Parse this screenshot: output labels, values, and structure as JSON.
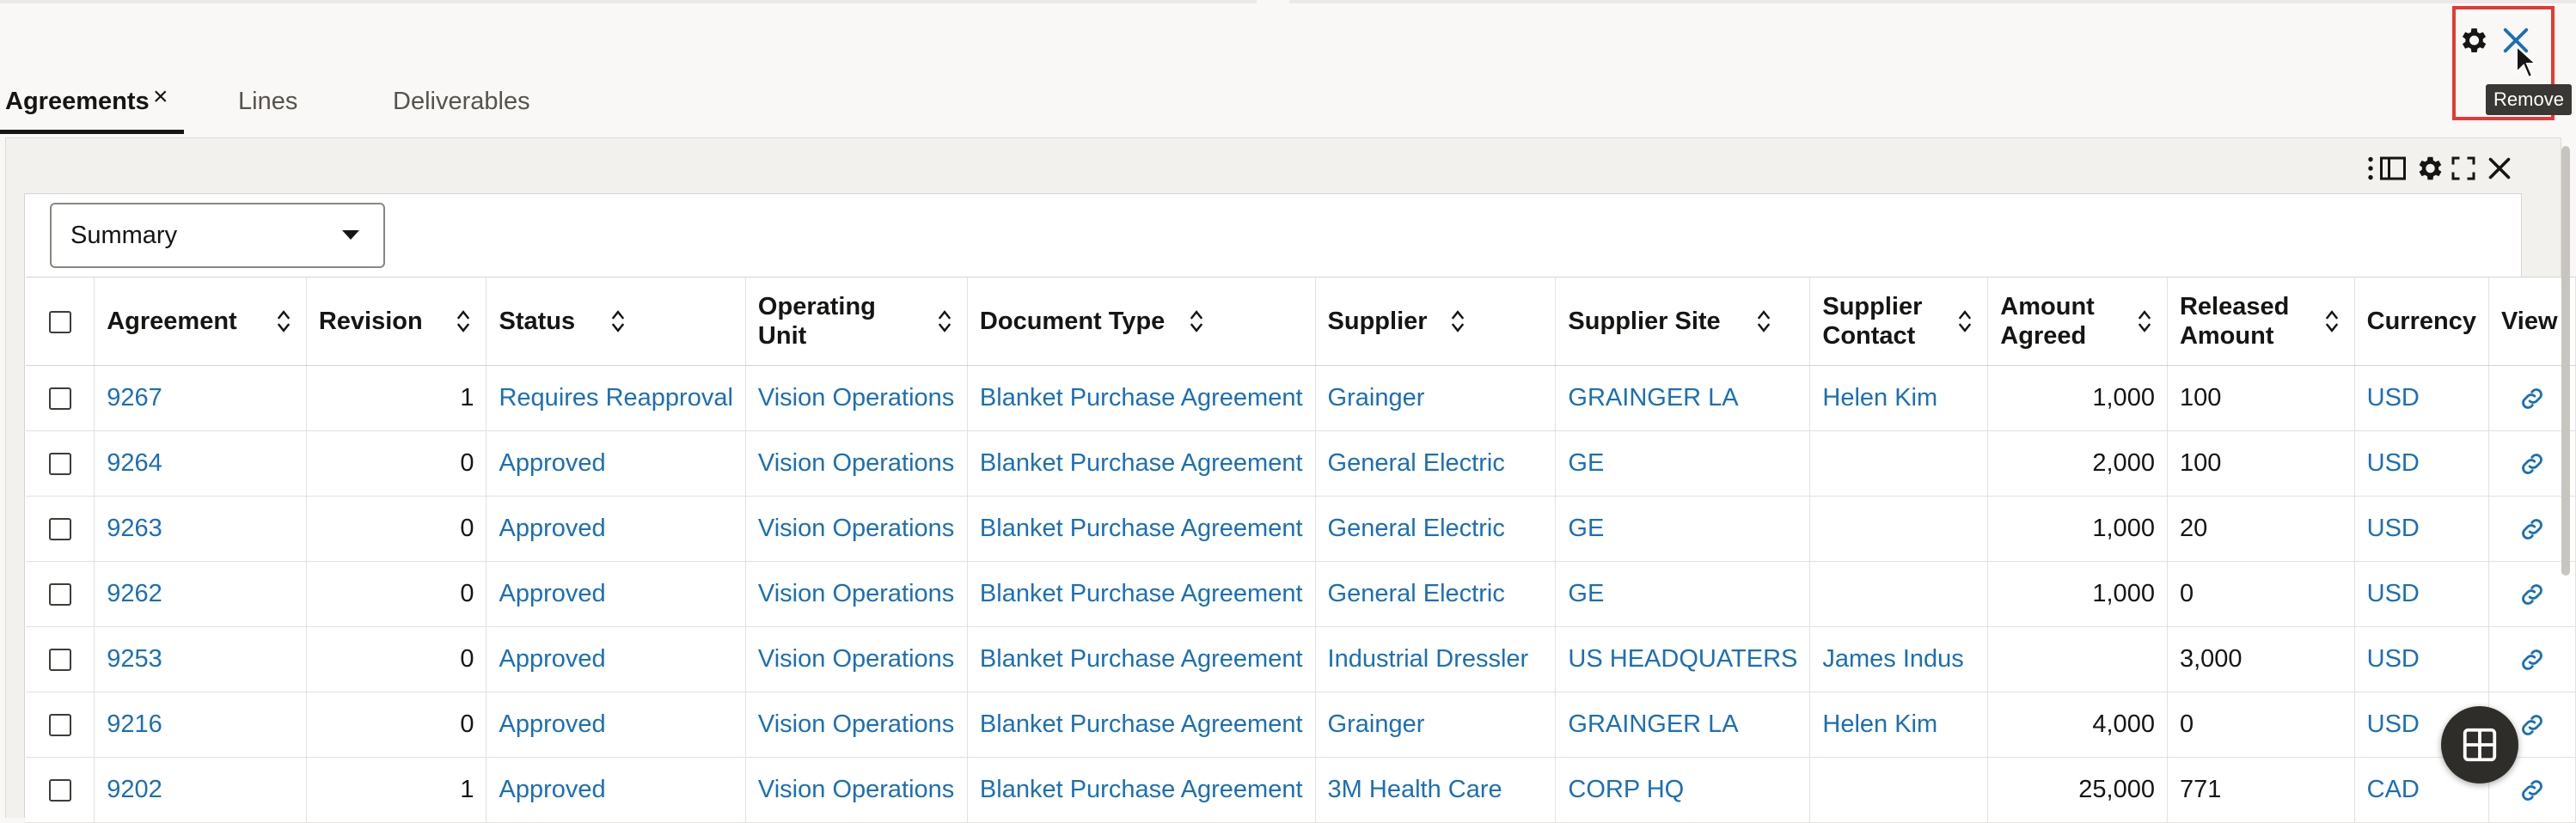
{
  "header": {
    "remove_tooltip": "Remove",
    "settings_icon": "gear-icon",
    "close_icon": "close-icon"
  },
  "tabs": [
    {
      "label": "Agreements",
      "active": true
    },
    {
      "label": "Lines",
      "active": false
    },
    {
      "label": "Deliverables",
      "active": false
    }
  ],
  "panel": {
    "tools": [
      "more-vertical-icon",
      "panel-toggle-icon",
      "gear-icon",
      "expand-icon",
      "close-icon"
    ]
  },
  "view_select": {
    "value": "Summary"
  },
  "table": {
    "columns": [
      {
        "label": "Agreement",
        "sortable": true
      },
      {
        "label": "Revision",
        "sortable": true
      },
      {
        "label": "Status",
        "sortable": true
      },
      {
        "label": "Operating Unit",
        "sortable": true
      },
      {
        "label": "Document Type",
        "sortable": true
      },
      {
        "label": "Supplier",
        "sortable": true
      },
      {
        "label": "Supplier Site",
        "sortable": true
      },
      {
        "label": "Supplier Contact",
        "sortable": true
      },
      {
        "label": "Amount Agreed",
        "sortable": true
      },
      {
        "label": "Released Amount",
        "sortable": true
      },
      {
        "label": "Currency",
        "sortable": false
      },
      {
        "label": "View",
        "sortable": false
      }
    ],
    "rows": [
      {
        "agreement": "9267",
        "revision": "1",
        "status": "Requires Reapproval",
        "operating_unit": "Vision Operations",
        "document_type": "Blanket Purchase Agreement",
        "supplier": "Grainger",
        "supplier_site": "GRAINGER LA",
        "supplier_contact": "Helen Kim",
        "amount_agreed": "1,000",
        "released_amount": "100",
        "currency": "USD"
      },
      {
        "agreement": "9264",
        "revision": "0",
        "status": "Approved",
        "operating_unit": "Vision Operations",
        "document_type": "Blanket Purchase Agreement",
        "supplier": "General Electric",
        "supplier_site": "GE",
        "supplier_contact": "",
        "amount_agreed": "2,000",
        "released_amount": "100",
        "currency": "USD"
      },
      {
        "agreement": "9263",
        "revision": "0",
        "status": "Approved",
        "operating_unit": "Vision Operations",
        "document_type": "Blanket Purchase Agreement",
        "supplier": "General Electric",
        "supplier_site": "GE",
        "supplier_contact": "",
        "amount_agreed": "1,000",
        "released_amount": "20",
        "currency": "USD"
      },
      {
        "agreement": "9262",
        "revision": "0",
        "status": "Approved",
        "operating_unit": "Vision Operations",
        "document_type": "Blanket Purchase Agreement",
        "supplier": "General Electric",
        "supplier_site": "GE",
        "supplier_contact": "",
        "amount_agreed": "1,000",
        "released_amount": "0",
        "currency": "USD"
      },
      {
        "agreement": "9253",
        "revision": "0",
        "status": "Approved",
        "operating_unit": "Vision Operations",
        "document_type": "Blanket Purchase Agreement",
        "supplier": "Industrial Dressler",
        "supplier_site": "US HEADQUATERS",
        "supplier_contact": "James Indus",
        "amount_agreed": "",
        "released_amount": "3,000",
        "currency": "USD"
      },
      {
        "agreement": "9216",
        "revision": "0",
        "status": "Approved",
        "operating_unit": "Vision Operations",
        "document_type": "Blanket Purchase Agreement",
        "supplier": "Grainger",
        "supplier_site": "GRAINGER LA",
        "supplier_contact": "Helen Kim",
        "amount_agreed": "4,000",
        "released_amount": "0",
        "currency": "USD"
      },
      {
        "agreement": "9202",
        "revision": "1",
        "status": "Approved",
        "operating_unit": "Vision Operations",
        "document_type": "Blanket Purchase Agreement",
        "supplier": "3M Health Care",
        "supplier_site": "CORP HQ",
        "supplier_contact": "",
        "amount_agreed": "25,000",
        "released_amount": "771",
        "currency": "CAD"
      }
    ]
  },
  "colors": {
    "link": "#1b6fb5",
    "highlight": "#e53935",
    "text": "#161513"
  }
}
